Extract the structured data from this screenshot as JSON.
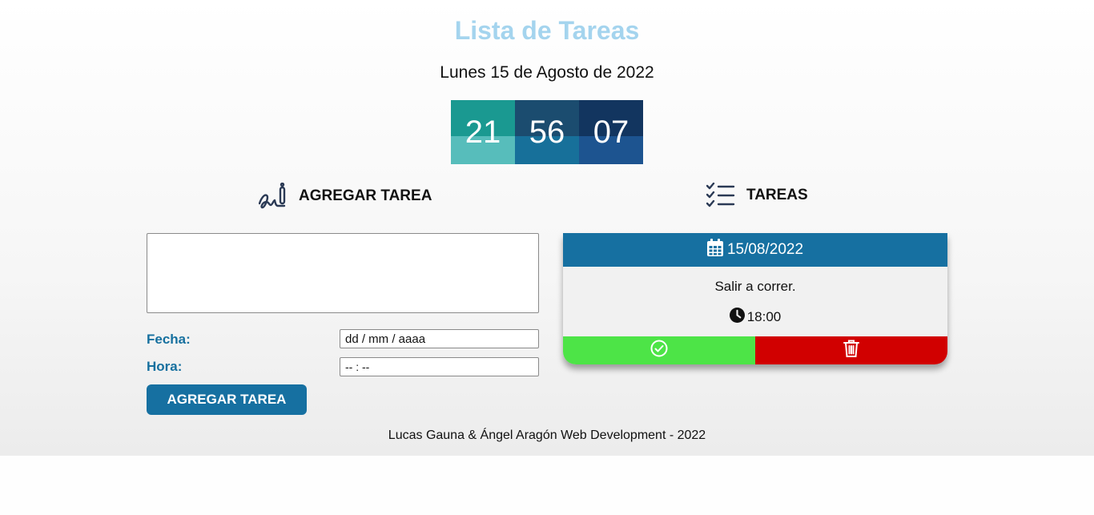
{
  "header": {
    "title": "Lista de Tareas",
    "date_text": "Lunes 15 de Agosto de 2022"
  },
  "clock": {
    "hours": "21",
    "minutes": "56",
    "seconds": "07"
  },
  "add_section": {
    "heading": "AGREGAR TAREA",
    "icon": "signature-pen-icon",
    "task_text": "",
    "fecha_label": "Fecha:",
    "fecha_placeholder": "dd / mm / aaaa",
    "hora_label": "Hora:",
    "hora_placeholder": "-- : --",
    "submit_label": "AGREGAR TAREA"
  },
  "tasks_section": {
    "heading": "TAREAS",
    "icon": "checklist-icon",
    "tasks": [
      {
        "date": "15/08/2022",
        "text": "Salir a correr.",
        "time": "18:00",
        "complete_icon": "check-circle-icon",
        "delete_icon": "trash-icon"
      }
    ]
  },
  "footer": {
    "text": "Lucas Gauna & Ángel Aragón Web Development - 2022"
  },
  "colors": {
    "title": "#a4d4ee",
    "accent": "#1670a1",
    "complete": "#4de447",
    "delete": "#d10000"
  }
}
